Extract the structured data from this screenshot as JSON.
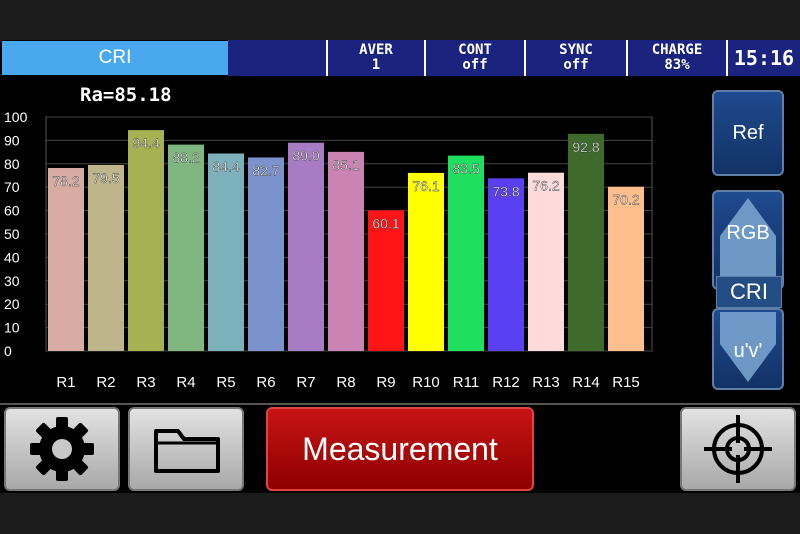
{
  "status_bar": {
    "mode": "CRI",
    "averaging": {
      "label": "AVER",
      "value": "1"
    },
    "contrast": {
      "label": "CONT",
      "value": "off"
    },
    "sync": {
      "label": "SYNC",
      "value": "off"
    },
    "charge": {
      "label": "CHARGE",
      "value": "83%"
    },
    "clock": "15:16"
  },
  "ra_readout": "Ra=85.18",
  "side_buttons": {
    "ref": "Ref",
    "rgb": "RGB",
    "cri": "CRI",
    "uv": "u'v'"
  },
  "bottom_bar": {
    "measure": "Measurement",
    "settings_icon": "gear-icon",
    "folder_icon": "folder-icon",
    "target_icon": "crosshair-icon"
  },
  "chart_data": {
    "type": "bar",
    "categories": [
      "R1",
      "R2",
      "R3",
      "R4",
      "R5",
      "R6",
      "R7",
      "R8",
      "R9",
      "R10",
      "R11",
      "R12",
      "R13",
      "R14",
      "R15"
    ],
    "values": [
      78.2,
      79.5,
      94.4,
      88.2,
      84.4,
      82.7,
      89.0,
      85.1,
      60.1,
      76.1,
      83.5,
      73.8,
      76.2,
      92.8,
      70.2
    ],
    "labels": [
      "78.2",
      "79.5",
      "94.4",
      "88.2",
      "84.4",
      "82.7",
      "89.0",
      "85.1",
      "60.1",
      "76.1",
      "83.5",
      "73.8",
      "76.2",
      "92.8",
      "70.2"
    ],
    "colors": [
      "#d8aca2",
      "#bfb58a",
      "#a5b251",
      "#80b67f",
      "#7cb1bb",
      "#7c92cc",
      "#a87cc4",
      "#cb83b4",
      "#ff1515",
      "#ffff00",
      "#1ee05e",
      "#5a40f0",
      "#ffdada",
      "#3e6a2c",
      "#ffbe8c"
    ],
    "ylim": [
      0,
      100
    ],
    "yticks": [
      "0",
      "10",
      "20",
      "30",
      "40",
      "50",
      "60",
      "70",
      "80",
      "90",
      "100"
    ],
    "grid": true
  }
}
